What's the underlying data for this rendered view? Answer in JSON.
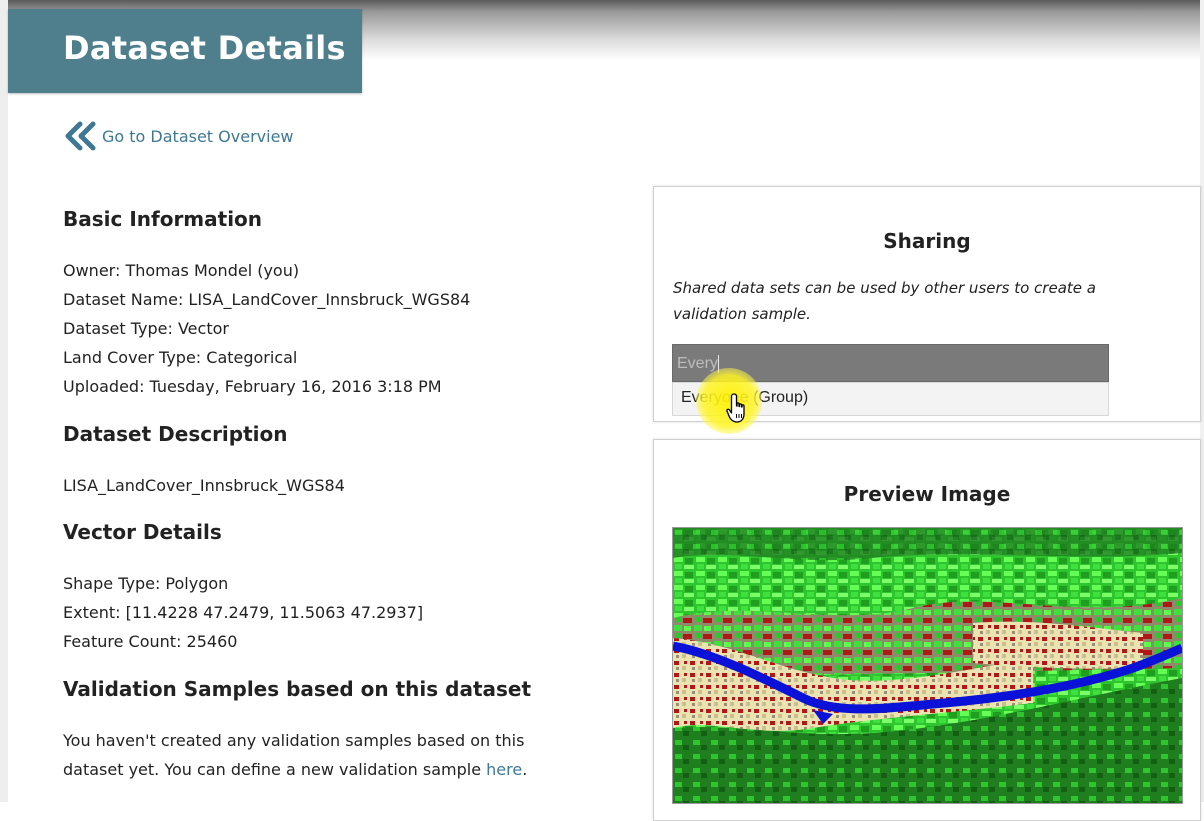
{
  "page": {
    "title": "Dataset Details",
    "back_link": "Go to Dataset Overview"
  },
  "basic_info": {
    "heading": "Basic Information",
    "owner": "Owner: Thomas Mondel (you)",
    "dataset_name": "Dataset Name: LISA_LandCover_Innsbruck_WGS84",
    "dataset_type": "Dataset Type: Vector",
    "land_cover_type": "Land Cover Type: Categorical",
    "uploaded": "Uploaded: Tuesday, February 16, 2016 3:18 PM"
  },
  "description": {
    "heading": "Dataset Description",
    "text": "LISA_LandCover_Innsbruck_WGS84"
  },
  "vector_details": {
    "heading": "Vector Details",
    "shape_type": "Shape Type: Polygon",
    "extent": "Extent: [11.4228 47.2479, 11.5063 47.2937]",
    "feature_count": "Feature Count: 25460"
  },
  "validation": {
    "heading": "Validation Samples based on this dataset",
    "text_1": "You haven't created any validation samples based on this",
    "text_2": "dataset yet. You can define a new validation sample ",
    "link": "here",
    "text_3": "."
  },
  "sharing": {
    "heading": "Sharing",
    "description": "Shared data sets can be used by other users to create a validation sample.",
    "input_value": "Every",
    "suggestion": "Everyone (Group)"
  },
  "preview": {
    "heading": "Preview Image"
  },
  "colors": {
    "header_bg": "#4f7f8c",
    "link": "#3f7893",
    "map_green": "#2fc52f",
    "map_river": "#0a12d8"
  },
  "icons": {
    "back": "double-chevron-left-icon",
    "cursor": "hand-pointer-icon"
  }
}
